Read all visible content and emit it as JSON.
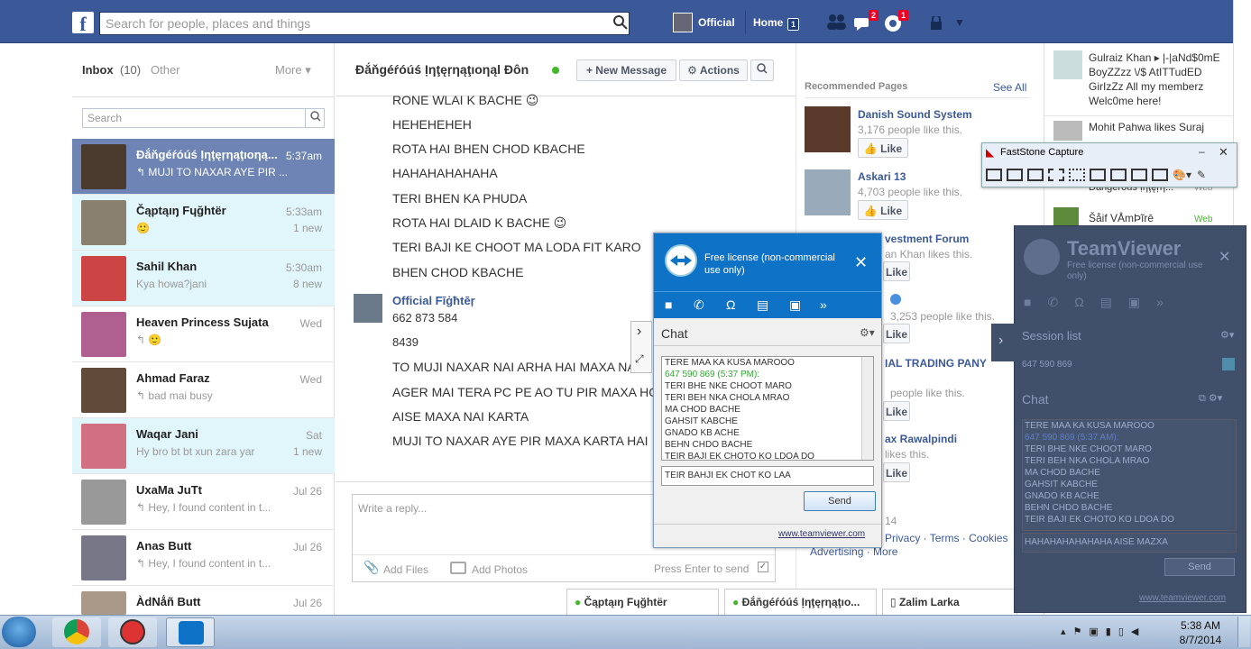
{
  "topbar": {
    "search_placeholder": "Search for people, places and things",
    "profile_name": "Official",
    "home_label": "Home",
    "home_badge": "1",
    "messages_badge": "2",
    "notifications_badge": "1"
  },
  "inbox": {
    "title": "Inbox",
    "count": "(10)",
    "other": "Other",
    "more": "More",
    "search_placeholder": "Search",
    "conversations": [
      {
        "name": "Đắňgéŕóúś Ịηţęŗηąţıoηą...",
        "snippet": "↰ MUJI TO NAXAR AYE PIR ...",
        "time": "5:37am",
        "extra": ""
      },
      {
        "name": "Čąptąıŋ Fɥğhtër",
        "snippet": "🙂",
        "time": "5:33am",
        "extra": "1 new"
      },
      {
        "name": "Sahil Khan",
        "snippet": "Kya howa?jani",
        "time": "5:30am",
        "extra": "8 new"
      },
      {
        "name": "Heaven Princess Sujata",
        "snippet": "↰ 🙂",
        "time": "Wed",
        "extra": ""
      },
      {
        "name": "Ahmad Faraz",
        "snippet": "↰ bad mai busy",
        "time": "Wed",
        "extra": ""
      },
      {
        "name": "Waqar Jani",
        "snippet": "Hy bro bt bt xun zara yar",
        "time": "Sat",
        "extra": "1 new"
      },
      {
        "name": "UxaMa JuTt",
        "snippet": "↰ Hey, I found content in t...",
        "time": "Jul 26",
        "extra": ""
      },
      {
        "name": "Anas Butt",
        "snippet": "↰ Hey, I found content in t...",
        "time": "Jul 26",
        "extra": ""
      },
      {
        "name": "ÀdNǻñ Butt",
        "snippet": "",
        "time": "Jul 26",
        "extra": ""
      }
    ]
  },
  "conversation": {
    "title": "Đắňgéŕóúś Ịηţęŗηąţıoηąl Đôn",
    "new_message": "+ New Message",
    "actions": "Actions",
    "messages": [
      "RONE WLAI K BACHE 😉",
      "HEHEHEHEH",
      "ROTA HAI BHEN CHOD KBACHE",
      "HAHAHAHAHAHA",
      "TERI BHEN KA PHUDA",
      "ROTA HAI DLAID K BACHE 😉",
      "TERI BAJI KE CHOOT MA LODA FIT KARO",
      "BHEN CHOD KBACHE"
    ],
    "sender2": "Official Fīġħtēŗ",
    "messages2": [
      "662 873 584",
      "8439",
      "TO MUJI NAXAR NAI ARHA HAI MAXA NAI K",
      "AGER MAI TERA PC PE AO TU PIR MAXA HOT",
      "AISE MAXA NAI KARTA",
      "MUJI TO NAXAR AYE PIR MAXA KARTA HAI"
    ],
    "reply_placeholder": "Write a reply...",
    "add_files": "Add Files",
    "add_photos": "Add Photos",
    "press_enter": "Press Enter to send"
  },
  "recommended": {
    "title": "Recommended Pages",
    "see_all": "See All",
    "pages": [
      {
        "name": "Danish Sound System",
        "likes": "3,176 people like this."
      },
      {
        "name": "Askari 13",
        "likes": "4,703 people like this."
      },
      {
        "name": "vestment Forum",
        "likes": "an Khan likes this."
      },
      {
        "name": "",
        "likes": "3,253 people like this."
      },
      {
        "name": "IAL TRADING PANY",
        "likes": "people like this."
      },
      {
        "name": "ax Rawalpindi",
        "likes": "likes this."
      }
    ],
    "like_label": "Like",
    "footer_year": "14",
    "footer_links": "Privacy · Terms · Cookies",
    "footer_links2": "Advertising · More"
  },
  "ticker": {
    "items": [
      {
        "text": "Gulraiz Khan ▸ |-|aNd$0mE BoyZZzz \\/$ AtITTudED GirIzZz All my memberz Welc0me here!"
      },
      {
        "text": "Mohit Pahwa likes Suraj"
      }
    ],
    "dangerous": "Đắňgéŕóúś Ịηţęŗη...",
    "web": "Web",
    "saif": "Šåif VÅmÞĩrē"
  },
  "faststone": {
    "title": "FastStone Capture"
  },
  "teamviewer_small": {
    "license": "Free license (non-commercial use only)",
    "chat_title": "Chat",
    "log": [
      "TERE MAA KA KUSA MAROOO",
      "647 590 869 (5:37 PM):",
      "TERI BHE NKE CHOOT MARO",
      "TERI BEH NKA CHOLA MRAO",
      "MA CHOD BACHE",
      "GAHSIT KABCHE",
      "GNADO KB ACHE",
      "BEHN CHDO BACHE",
      "TEIR BAJI EK CHOTO KO LDOA DO"
    ],
    "input": "TEIR BAHJI EK CHOT KO LAA",
    "send": "Send",
    "link": "www.teamviewer.com"
  },
  "teamviewer_big": {
    "title": "TeamViewer",
    "license": "Free license (non-commercial use only)",
    "session_list": "Session list",
    "session_id": "647 590 869",
    "chat_title": "Chat",
    "log": [
      "TERE MAA KA KUSA MAROOO",
      "647 590 869 (5:37 AM):",
      "TERI BHE NKE CHOOT MARO",
      "TERI BEH NKA CHOLA MRAO",
      "MA CHOD BACHE",
      "GAHSIT KABCHE",
      "GNADO KB ACHE",
      "BEHN CHDO BACHE",
      "TEIR BAJI EK CHOTO KO LDOA DO"
    ],
    "input": "HAHAHAHAHAHAHA AISE MAZXA",
    "send": "Send",
    "link": "www.teamviewer.com"
  },
  "chat_tabs": [
    "Čąptąıŋ Fɥğhtër",
    "Đắňgéŕóúś Ịηţęŗηąţıo...",
    "Zalim Larka"
  ],
  "taskbar": {
    "time": "5:38 AM",
    "date": "8/7/2014"
  }
}
